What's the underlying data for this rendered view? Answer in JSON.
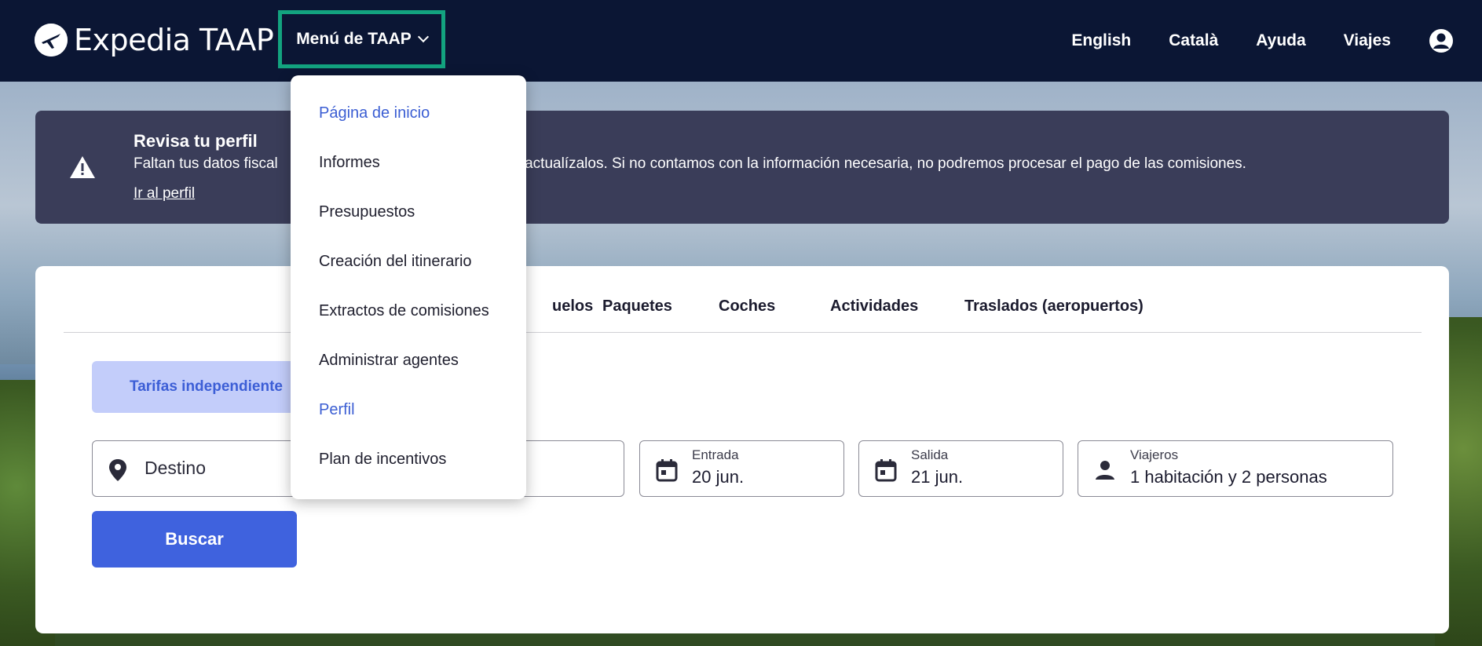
{
  "header": {
    "logo_text": "Expedia TAAP",
    "menu_label": "Menú de TAAP",
    "nav": [
      "English",
      "Català",
      "Ayuda",
      "Viajes"
    ]
  },
  "alert": {
    "title": "Revisa tu perfil",
    "text_visible_left": "Faltan tus datos fiscal",
    "text_visible_right": "fil y actualízalos. Si no contamos con la información necesaria, no podremos procesar el pago de las comisiones.",
    "link": "Ir al perfil"
  },
  "search": {
    "tabs": [
      "uelos",
      "Paquetes",
      "Coches",
      "Actividades",
      "Traslados (aeropuertos)"
    ],
    "rate_pill": "Tarifas independiente",
    "destination_placeholder": "Destino",
    "checkin_label": "Entrada",
    "checkin_value": "20 jun.",
    "checkout_label": "Salida",
    "checkout_value": "21 jun.",
    "travelers_label": "Viajeros",
    "travelers_value": "1 habitación y 2 personas",
    "search_button": "Buscar"
  },
  "dropdown": {
    "items": [
      {
        "label": "Página de inicio",
        "active": true
      },
      {
        "label": "Informes",
        "active": false
      },
      {
        "label": "Presupuestos",
        "active": false
      },
      {
        "label": "Creación del itinerario",
        "active": false
      },
      {
        "label": "Extractos de comisiones",
        "active": false
      },
      {
        "label": "Administrar agentes",
        "active": false
      },
      {
        "label": "Perfil",
        "active": true
      },
      {
        "label": "Plan de incentivos",
        "active": false
      }
    ]
  },
  "colors": {
    "header_bg": "#0b1634",
    "menu_highlight": "#13a37f",
    "alert_bg": "#3a3d59",
    "primary": "#3f62de",
    "link_active": "#3b5ed3"
  }
}
